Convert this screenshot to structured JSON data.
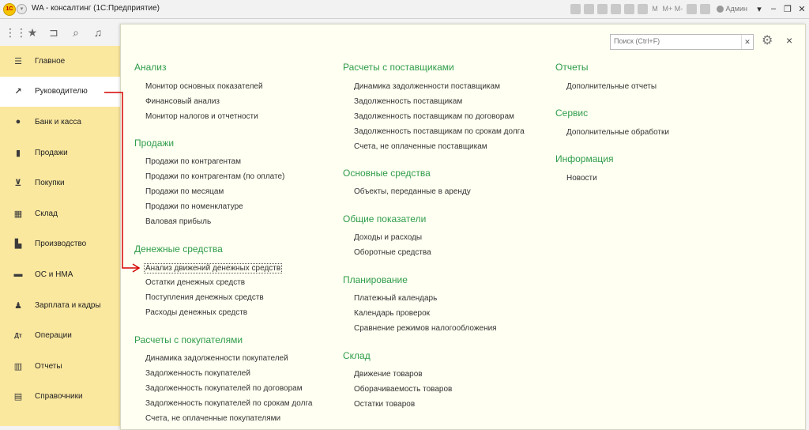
{
  "window": {
    "title": "WA - консалтинг  (1С:Предприятие)",
    "user": "Админ",
    "logo": "1С"
  },
  "titlebar_icons": [
    "print-icon",
    "save-icon",
    "calc-icon",
    "upload-icon",
    "list-icon",
    "calendar-icon",
    "M",
    "M+",
    "M-",
    "zoom-icon",
    "info-icon"
  ],
  "sidebar": {
    "items": [
      {
        "label": "Главное",
        "icon": "menu-icon"
      },
      {
        "label": "Руководителю",
        "icon": "trend-icon",
        "active": true
      },
      {
        "label": "Банк и касса",
        "icon": "coin-icon"
      },
      {
        "label": "Продажи",
        "icon": "bag-icon"
      },
      {
        "label": "Покупки",
        "icon": "cart-icon"
      },
      {
        "label": "Склад",
        "icon": "grid-icon"
      },
      {
        "label": "Производство",
        "icon": "factory-icon"
      },
      {
        "label": "ОС и НМА",
        "icon": "truck-icon"
      },
      {
        "label": "Зарплата и кадры",
        "icon": "person-icon"
      },
      {
        "label": "Операции",
        "icon": "operations-icon"
      },
      {
        "label": "Отчеты",
        "icon": "bar-chart-icon"
      },
      {
        "label": "Справочники",
        "icon": "book-icon"
      }
    ]
  },
  "search": {
    "placeholder": "Поиск (Ctrl+F)"
  },
  "sections": {
    "analysis": {
      "title": "Анализ",
      "links": [
        "Монитор основных показателей",
        "Финансовый анализ",
        "Монитор налогов и отчетности"
      ]
    },
    "sales": {
      "title": "Продажи",
      "links": [
        "Продажи по контрагентам",
        "Продажи по контрагентам (по оплате)",
        "Продажи по месяцам",
        "Продажи по номенклатуре",
        "Валовая прибыль"
      ]
    },
    "cash": {
      "title": "Денежные средства",
      "links": [
        "Анализ движений денежных средств",
        "Остатки денежных средств",
        "Поступления денежных средств",
        "Расходы денежных средств"
      ]
    },
    "customers": {
      "title": "Расчеты с покупателями",
      "links": [
        "Динамика задолженности покупателей",
        "Задолженность покупателей",
        "Задолженность покупателей по договорам",
        "Задолженность покупателей по срокам долга",
        "Счета, не оплаченные покупателями"
      ]
    },
    "suppliers": {
      "title": "Расчеты с поставщиками",
      "links": [
        "Динамика задолженности поставщикам",
        "Задолженность поставщикам",
        "Задолженность поставщикам по договорам",
        "Задолженность поставщикам по срокам долга",
        "Счета, не оплаченные поставщикам"
      ]
    },
    "assets": {
      "title": "Основные средства",
      "links": [
        "Объекты, переданные в аренду"
      ]
    },
    "general": {
      "title": "Общие показатели",
      "links": [
        "Доходы и расходы",
        "Оборотные средства"
      ]
    },
    "planning": {
      "title": "Планирование",
      "links": [
        "Платежный календарь",
        "Календарь проверок",
        "Сравнение режимов налогообложения"
      ]
    },
    "warehouse": {
      "title": "Склад",
      "links": [
        "Движение товаров",
        "Оборачиваемость товаров",
        "Остатки товаров"
      ]
    },
    "reports": {
      "title": "Отчеты",
      "links": [
        "Дополнительные отчеты"
      ]
    },
    "service": {
      "title": "Сервис",
      "links": [
        "Дополнительные обработки"
      ]
    },
    "info": {
      "title": "Информация",
      "links": [
        "Новости"
      ]
    }
  },
  "colors": {
    "sidebar_bg": "#fbe89f",
    "panel_bg": "#fffff2",
    "section_title": "#2f9d4a",
    "annotation_arrow": "#d60000"
  }
}
